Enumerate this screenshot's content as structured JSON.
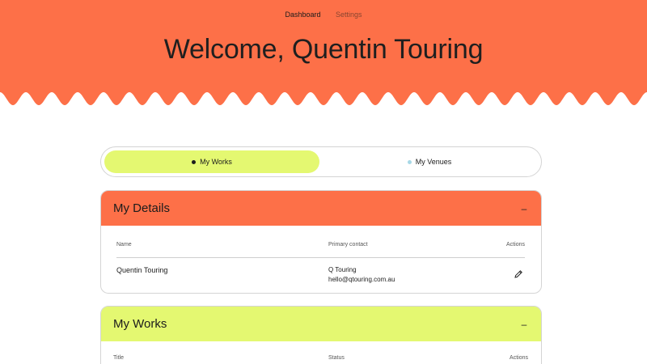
{
  "nav": {
    "items": [
      {
        "label": "Dashboard"
      },
      {
        "label": "Settings"
      }
    ]
  },
  "hero": {
    "title": "Welcome, Quentin Touring",
    "color": "#fd7048"
  },
  "tabs": [
    {
      "label": "My Works",
      "active": true
    },
    {
      "label": "My Venues",
      "active": false
    }
  ],
  "details": {
    "title": "My Details",
    "collapse_label": "–",
    "columns": {
      "name": "Name",
      "contact": "Primary contact",
      "actions": "Actions"
    },
    "row": {
      "name": "Quentin Touring",
      "contact_name": "Q Touring",
      "contact_email": "hello@qtouring.com.au",
      "action_icon": "pencil-icon"
    }
  },
  "works": {
    "title": "My Works",
    "collapse_label": "–",
    "columns": {
      "title": "Title",
      "status": "Status",
      "actions": "Actions"
    }
  },
  "colors": {
    "orange": "#fd7048",
    "lime": "#e4f871",
    "venue_dot": "#a7d8e6"
  }
}
